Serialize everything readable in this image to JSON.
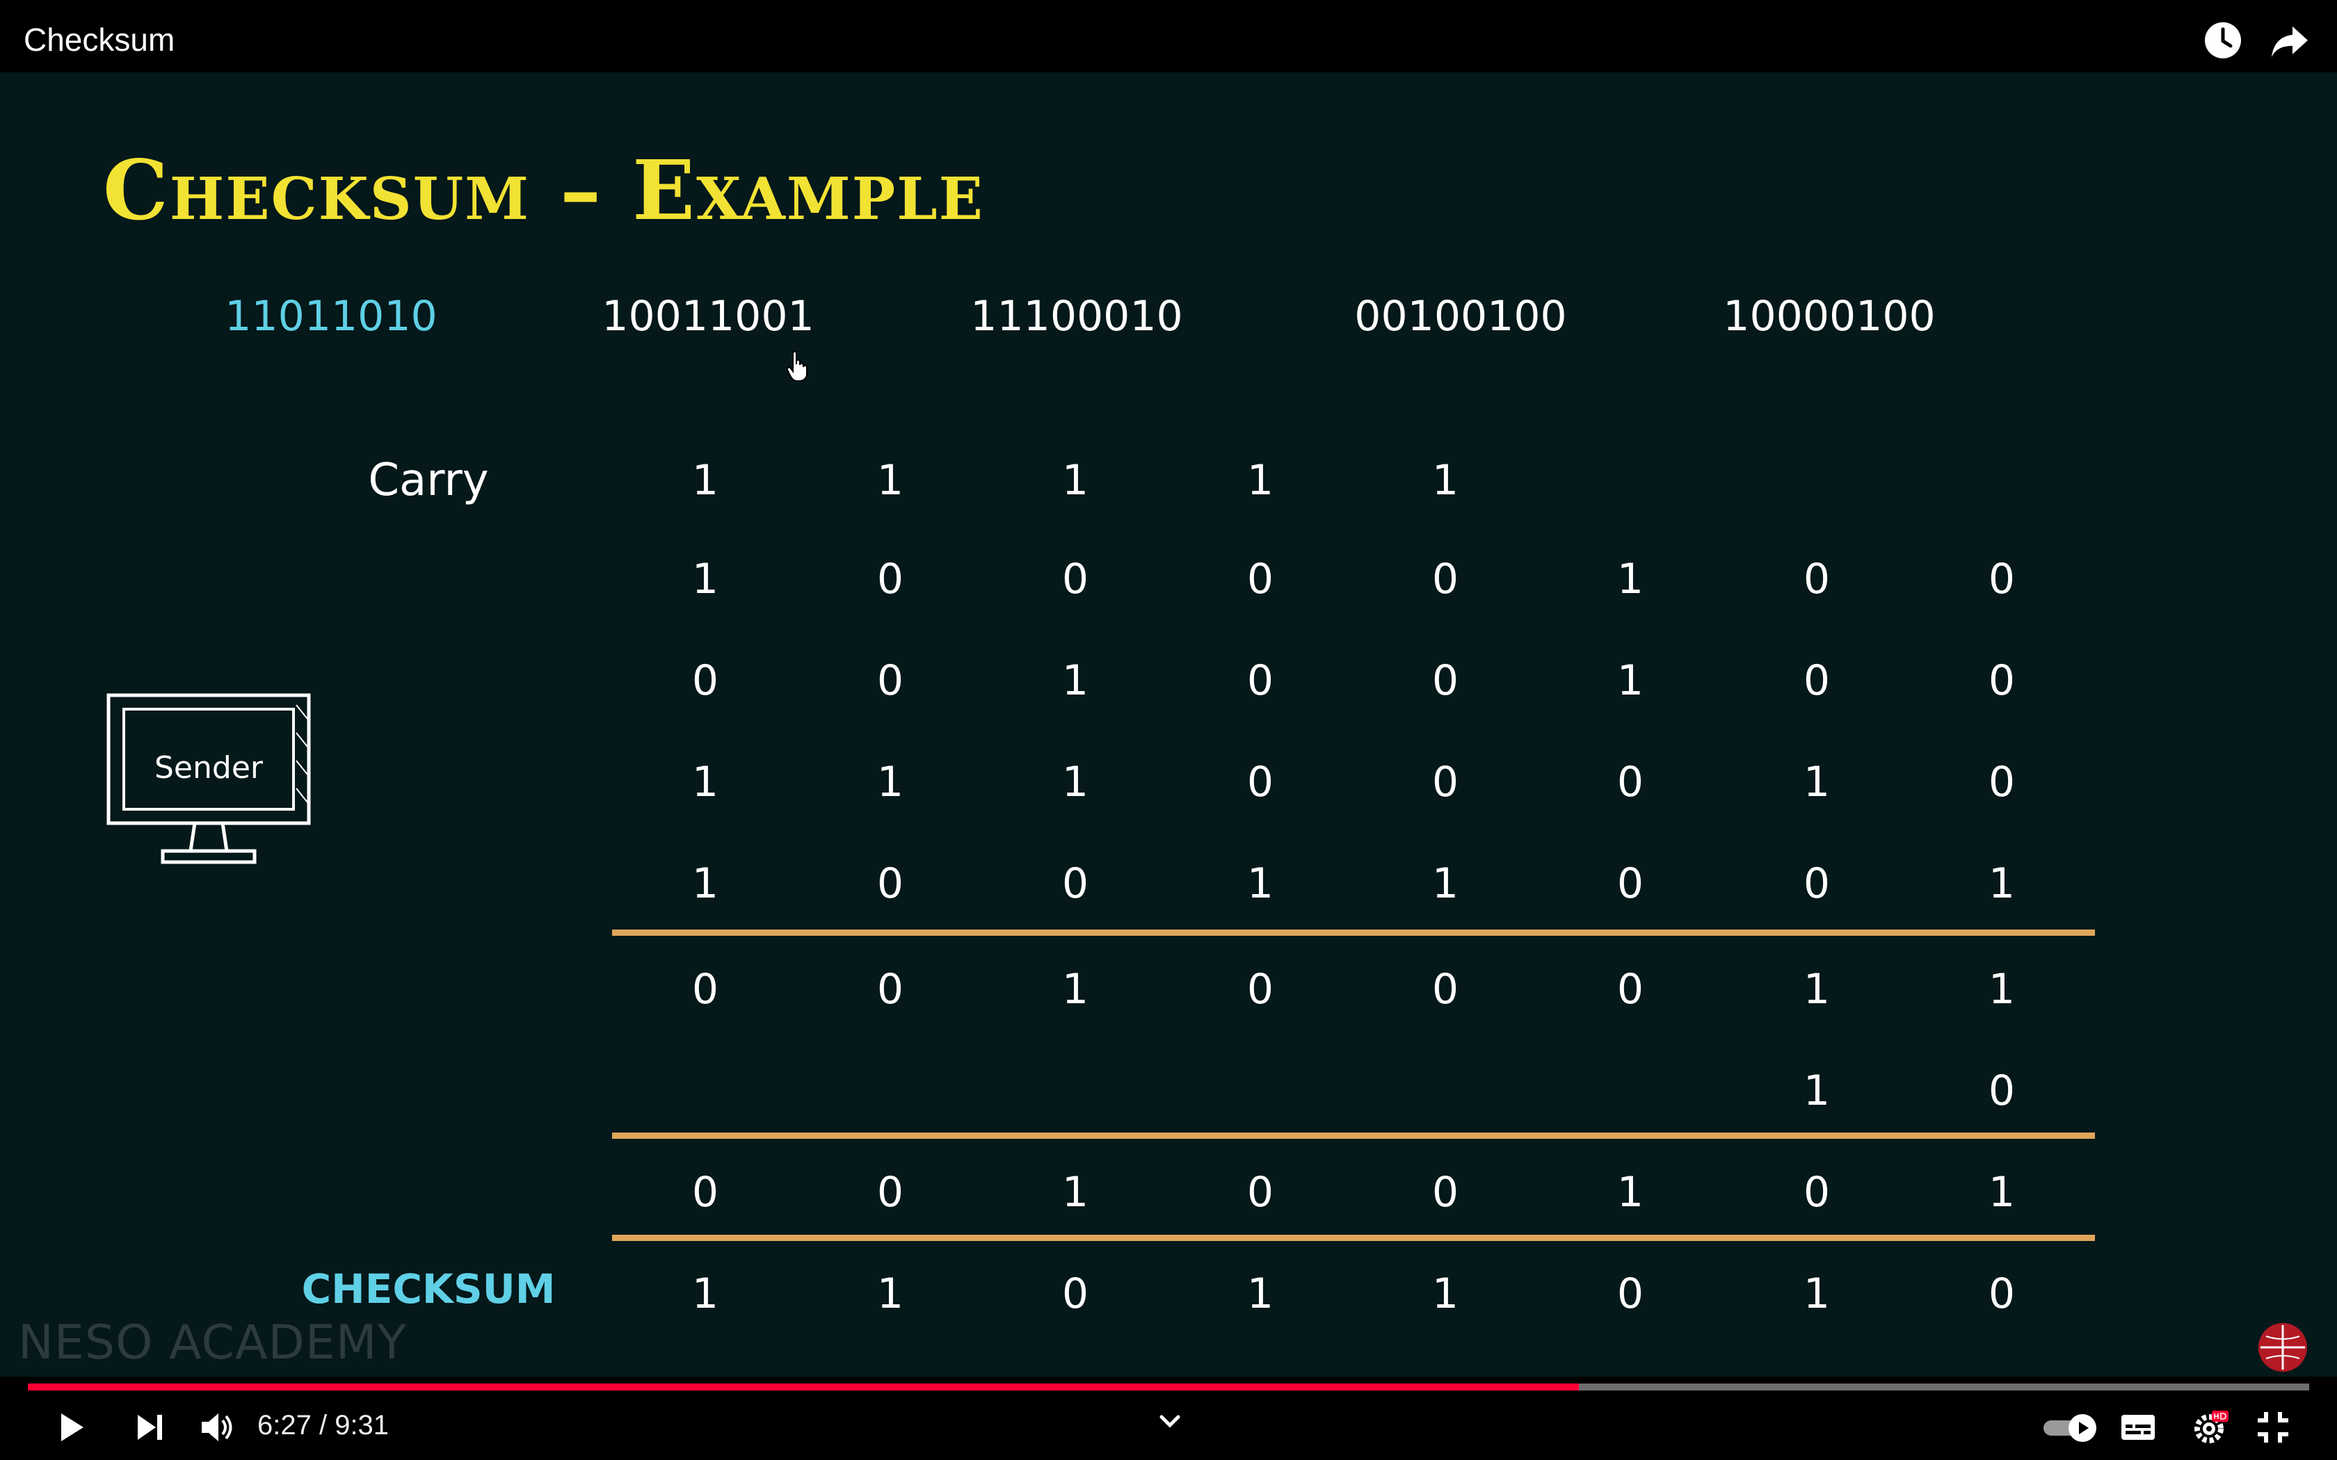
{
  "window": {
    "title": "Checksum"
  },
  "slide": {
    "title": "Checksum – Example",
    "words": [
      {
        "text": "11011010",
        "highlight": true
      },
      {
        "text": "10011001",
        "highlight": false
      },
      {
        "text": "11100010",
        "highlight": false
      },
      {
        "text": "00100100",
        "highlight": false
      },
      {
        "text": "10000100",
        "highlight": false
      }
    ],
    "carry_label": "Carry",
    "carry": [
      "1",
      "1",
      "1",
      "1",
      "1"
    ],
    "rows": [
      [
        "1",
        "0",
        "0",
        "0",
        "0",
        "1",
        "0",
        "0"
      ],
      [
        "0",
        "0",
        "1",
        "0",
        "0",
        "1",
        "0",
        "0"
      ],
      [
        "1",
        "1",
        "1",
        "0",
        "0",
        "0",
        "1",
        "0"
      ],
      [
        "1",
        "0",
        "0",
        "1",
        "1",
        "0",
        "0",
        "1"
      ],
      [
        "0",
        "0",
        "1",
        "0",
        "0",
        "0",
        "1",
        "1"
      ],
      [
        "",
        "",
        "",
        "",
        "",
        "",
        "1",
        "0"
      ],
      [
        "0",
        "0",
        "1",
        "0",
        "0",
        "1",
        "0",
        "1"
      ]
    ],
    "checksum_label": "CHECKSUM",
    "checksum": [
      "1",
      "1",
      "0",
      "1",
      "1",
      "0",
      "1",
      "0"
    ],
    "sender_label": "Sender",
    "watermark": "NESO ACADEMY",
    "colors": {
      "title": "#f2e233",
      "highlight": "#5fd0e6",
      "rule": "#e0a65a",
      "background": "#05181a"
    }
  },
  "player": {
    "current_time": "6:27",
    "duration": "9:31",
    "time_display": "6:27 / 9:31",
    "progress_fraction": 0.68,
    "progress_color": "#ff0033",
    "icons": [
      "play-icon",
      "next-icon",
      "volume-icon",
      "chevron-down-icon",
      "autoplay-toggle-icon",
      "captions-icon",
      "settings-icon",
      "exit-fullscreen-icon",
      "watch-later-icon",
      "share-icon"
    ]
  }
}
